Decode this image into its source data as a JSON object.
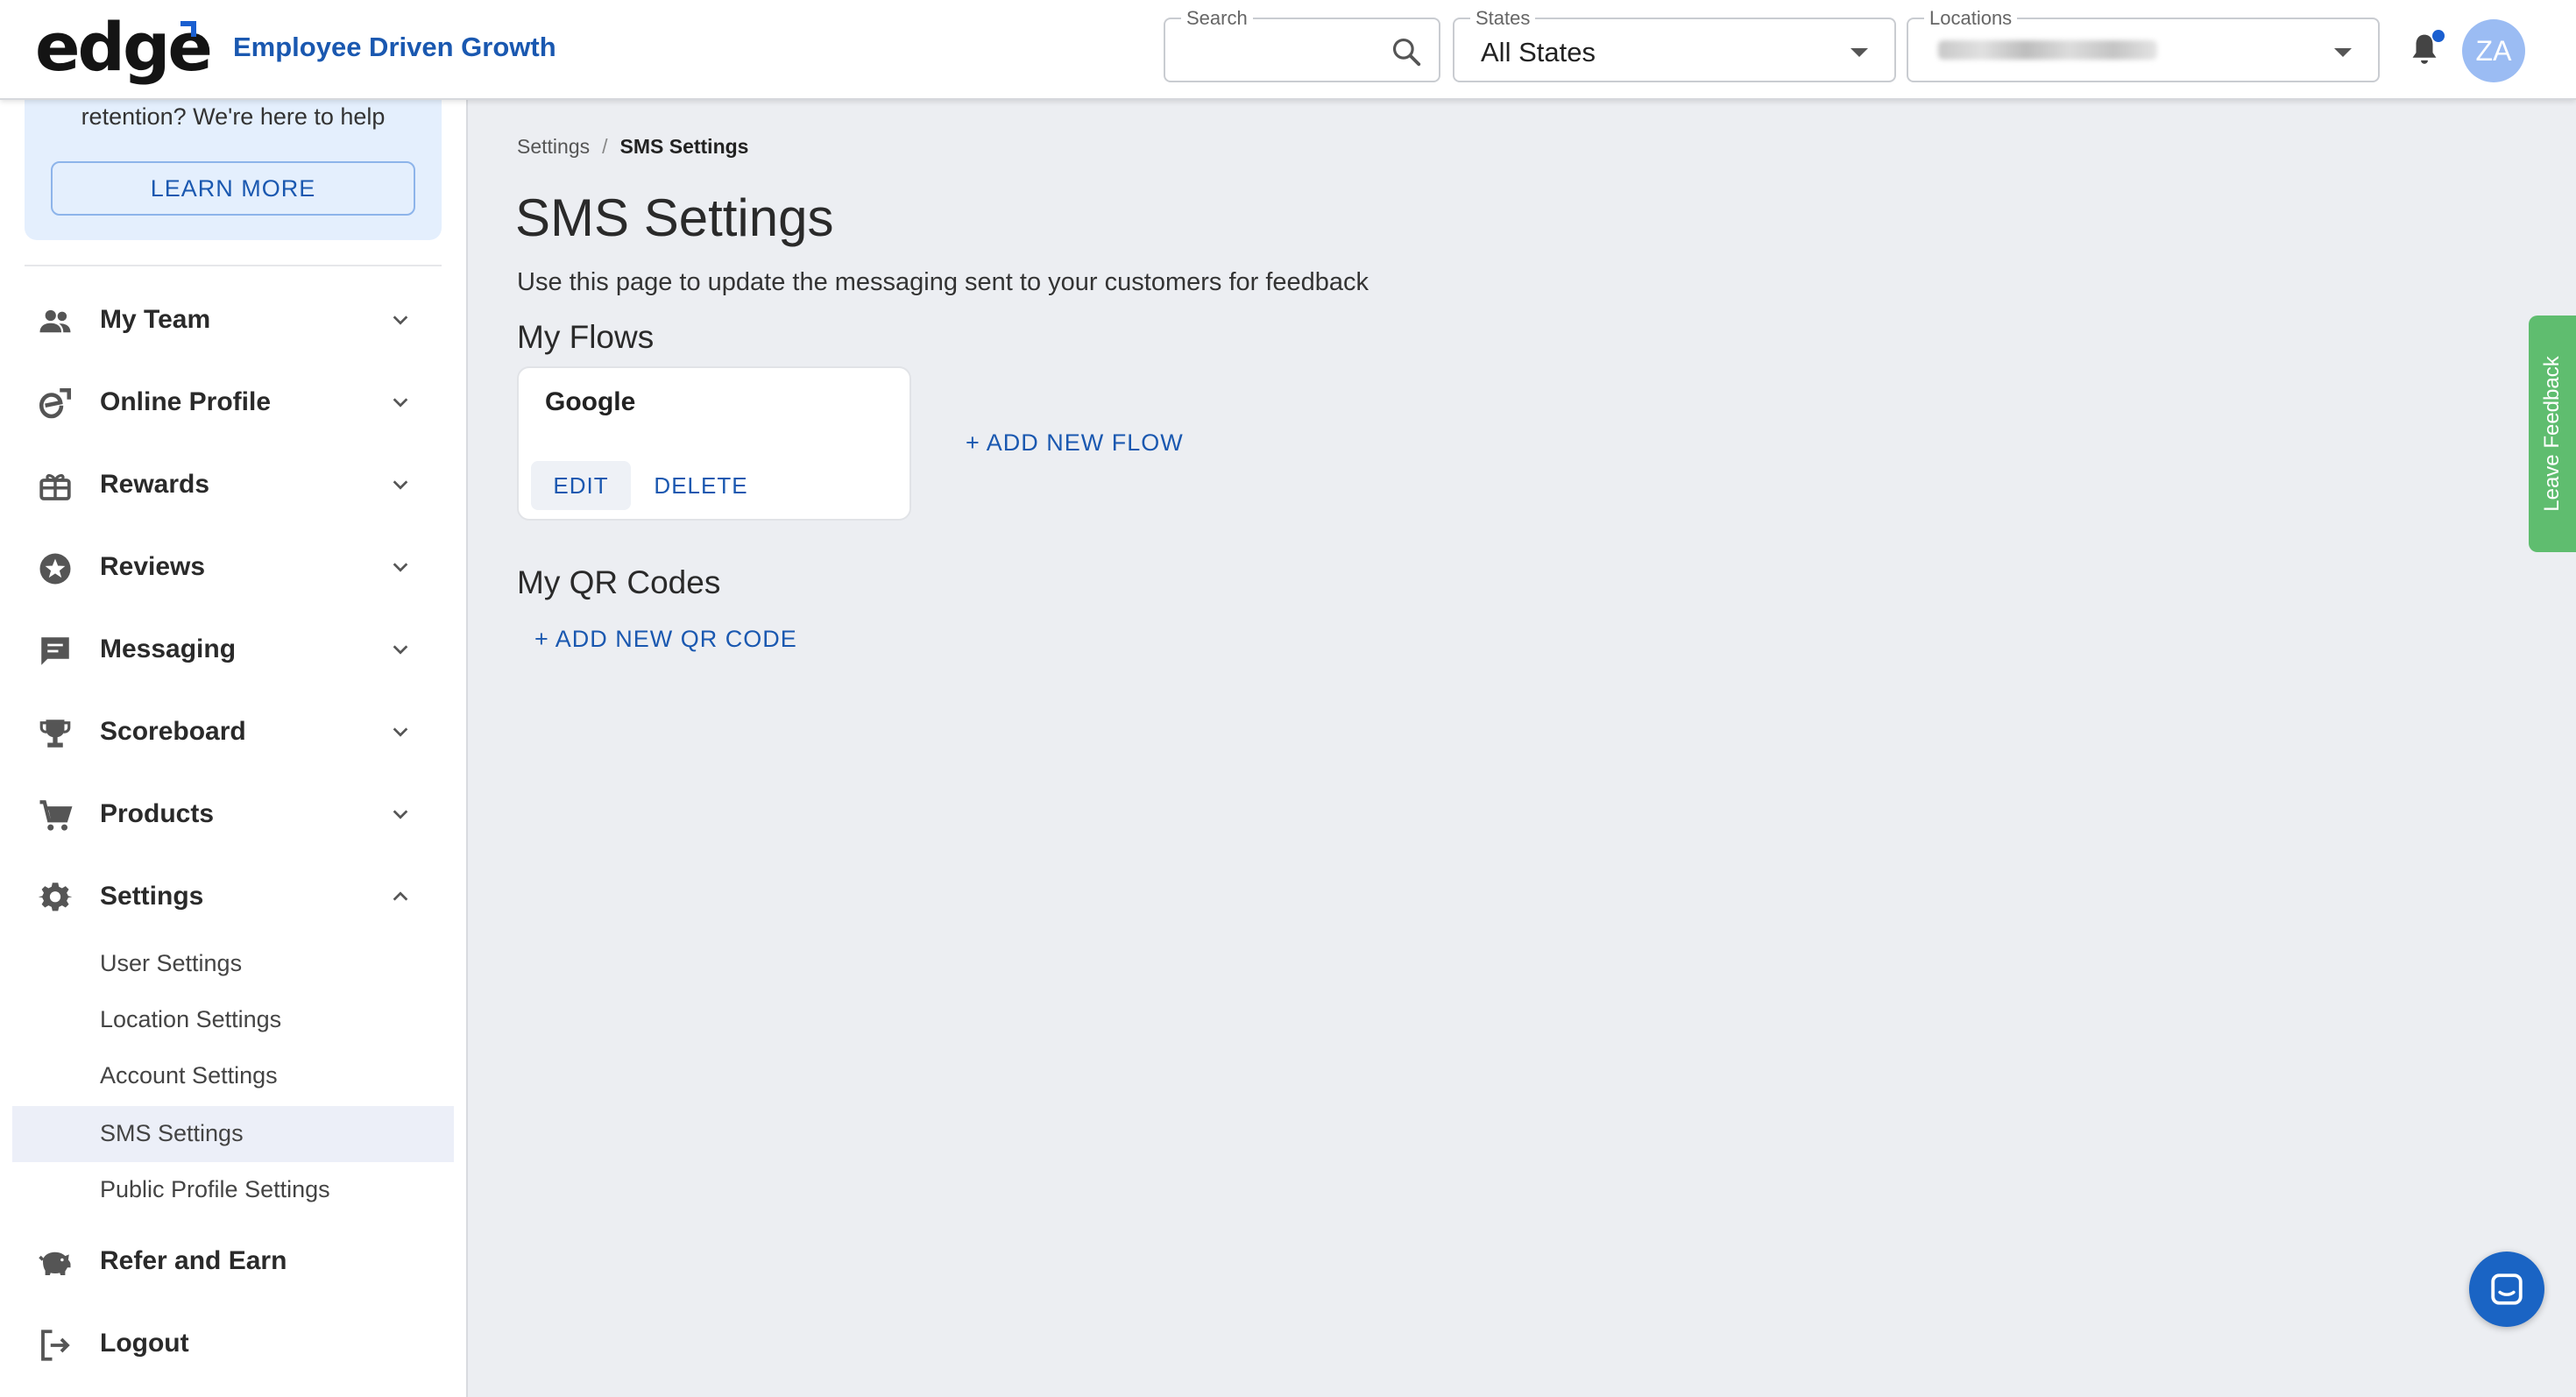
{
  "header": {
    "logo": "edge",
    "tagline": "Employee Driven Growth",
    "search": {
      "label": "Search",
      "value": ""
    },
    "states": {
      "label": "States",
      "value": "All States"
    },
    "locations": {
      "label": "Locations"
    },
    "avatar_initials": "ZA",
    "accent_color": "#1a58b0"
  },
  "sidebar": {
    "promo_text": "retention? We're here to help",
    "promo_button": "LEARN MORE",
    "items": [
      {
        "label": "My Team",
        "icon": "team-icon"
      },
      {
        "label": "Online Profile",
        "icon": "profile-icon"
      },
      {
        "label": "Rewards",
        "icon": "gift-icon"
      },
      {
        "label": "Reviews",
        "icon": "star-icon"
      },
      {
        "label": "Messaging",
        "icon": "message-icon"
      },
      {
        "label": "Scoreboard",
        "icon": "trophy-icon"
      },
      {
        "label": "Products",
        "icon": "cart-icon"
      },
      {
        "label": "Settings",
        "icon": "gear-icon"
      }
    ],
    "settings_subitems": [
      "User Settings",
      "Location Settings",
      "Account Settings",
      "SMS Settings",
      "Public Profile Settings"
    ],
    "refer": "Refer and Earn",
    "logout": "Logout"
  },
  "main": {
    "breadcrumb": {
      "parent": "Settings",
      "separator": "/",
      "current": "SMS Settings"
    },
    "title": "SMS Settings",
    "description": "Use this page to update the messaging sent to your customers for feedback",
    "flows_title": "My Flows",
    "flow_card": {
      "name": "Google",
      "edit": "EDIT",
      "delete": "DELETE"
    },
    "add_flow": "+ ADD NEW FLOW",
    "qr_title": "My QR Codes",
    "add_qr": "+ ADD NEW QR CODE"
  },
  "feedback_tab": "Leave Feedback"
}
